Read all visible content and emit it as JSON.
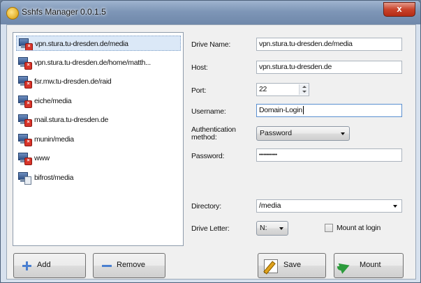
{
  "window": {
    "title": "Sshfs Manager 0.0.1.5",
    "close_label": "x"
  },
  "drives": [
    {
      "name": "vpn.stura.tu-dresden.de/media",
      "status": "disconnected"
    },
    {
      "name": "vpn.stura.tu-dresden.de/home/matth...",
      "status": "disconnected"
    },
    {
      "name": "fsr.mw.tu-dresden.de/raid",
      "status": "disconnected"
    },
    {
      "name": "eiche/media",
      "status": "disconnected"
    },
    {
      "name": "mail.stura.tu-dresden.de",
      "status": "disconnected"
    },
    {
      "name": "munin/media",
      "status": "disconnected"
    },
    {
      "name": "www",
      "status": "disconnected"
    },
    {
      "name": "bifrost/media",
      "status": "ok"
    }
  ],
  "form": {
    "drive_name_label": "Drive Name:",
    "drive_name": "vpn.stura.tu-dresden.de/media",
    "host_label": "Host:",
    "host": "vpn.stura.tu-dresden.de",
    "port_label": "Port:",
    "port": "22",
    "username_label": "Username:",
    "username": "Domain-Login",
    "auth_label_line1": "Authentication",
    "auth_label_line2": "method:",
    "auth_method": "Password",
    "password_label": "Password:",
    "password": "••••••••••••",
    "directory_label": "Directory:",
    "directory": "/media",
    "drive_letter_label": "Drive Letter:",
    "drive_letter": "N:",
    "mount_at_login_label": "Mount at login",
    "mount_at_login": false
  },
  "buttons": {
    "add": "Add",
    "remove": "Remove",
    "save": "Save",
    "mount": "Mount"
  }
}
